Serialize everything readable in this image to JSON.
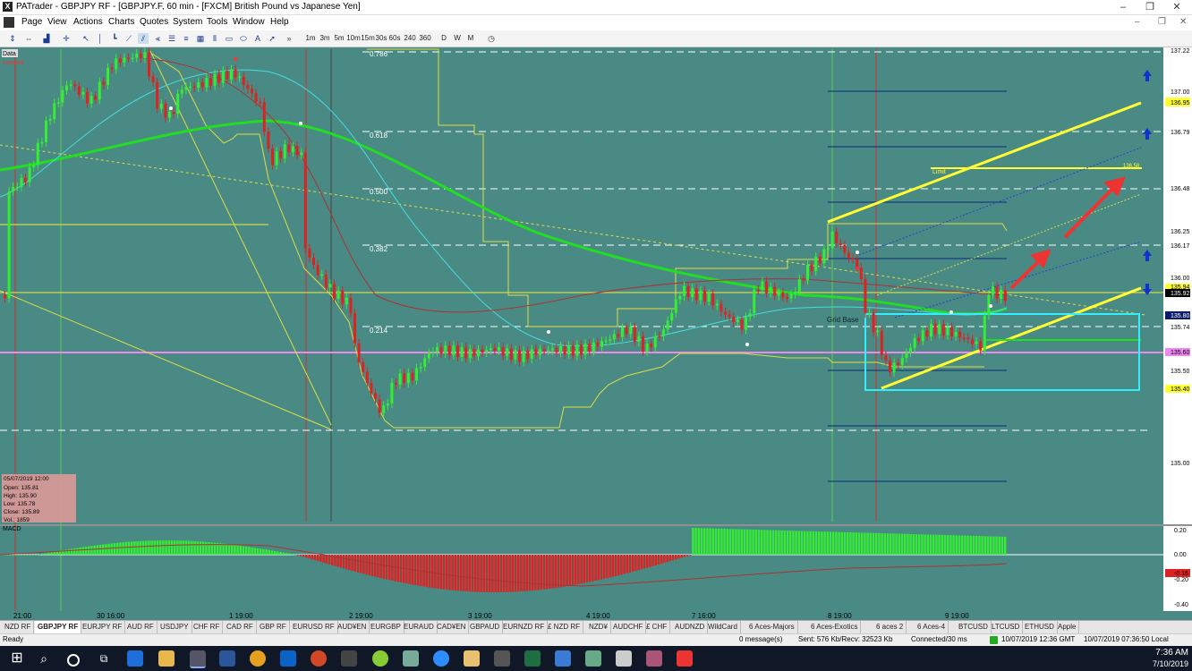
{
  "window": {
    "title": "PATrader - GBPJPY RF - [GBPJPY.F, 60 min - [FXCM] British Pound vs Japanese Yen]",
    "controls": [
      "–",
      "❐",
      "✕"
    ],
    "mdi_controls": [
      "–",
      "❐",
      "✕"
    ]
  },
  "menu": [
    "Page",
    "View",
    "Actions",
    "Charts",
    "Quotes",
    "System",
    "Tools",
    "Window",
    "Help"
  ],
  "toolbar": {
    "timeframes": [
      "1m",
      "3m",
      "5m",
      "10m",
      "15m",
      "30s",
      "60s",
      "240",
      "360"
    ],
    "periods": [
      "D",
      "W",
      "M"
    ],
    "more": "»"
  },
  "chart": {
    "data_label": "Data",
    "status_label": "Leased",
    "fib_levels": [
      "0.786",
      "0.618",
      "0.500",
      "0.382",
      "0.214"
    ],
    "grid_base_label": "Grid Base",
    "limit_label": "Limit",
    "limit_price": "136.58",
    "price_axis": [
      "137.22",
      "137.00",
      "136.95",
      "136.79",
      "136.48",
      "136.25",
      "136.17",
      "136.00",
      "135.94",
      "135.92",
      "135.80",
      "135.74",
      "135.60",
      "135.50",
      "135.40",
      "135.00"
    ],
    "time_axis": [
      "21:00",
      "30 16:00",
      "1 19:00",
      "2 19:00",
      "3 19:00",
      "4 19:00",
      "7 16:00",
      "8 19:00",
      "9 19:00"
    ],
    "info_box": {
      "date": "05/07/2019 12:00",
      "open": "Open: 135.81",
      "high": "High: 135.90",
      "low": "Low: 135.78",
      "close": "Close: 135.89",
      "vol": "Vol.: 1859"
    },
    "macd_label": "MACD",
    "macd_axis": [
      "0.20",
      "0.00",
      "-0.20",
      "-0.40"
    ],
    "macd_value": "-0.16",
    "colors": {
      "background": "#4a8a84",
      "bull": "#33ee33",
      "bear": "#dd2222",
      "ma_green": "#22dd22",
      "ma_cyan": "#44dddd",
      "yellow": "#ffff33",
      "magenta": "#ee88ee",
      "arrow": "#ee3333",
      "box": "#33eeff"
    }
  },
  "tabs": [
    "NZD RF",
    "GBPJPY RF",
    "EURJPY RF",
    "AUD RF",
    "USDJPY",
    "CHF RF",
    "CAD RF",
    "GBP RF",
    "EURUSD RF",
    "AUD¥EN",
    "EURGBP",
    "EURAUD",
    "CAD¥EN",
    "GBPAUD",
    "EURNZD RF",
    "£ NZD RF",
    "NZD¥",
    "AUDCHF",
    "£ CHF",
    "AUDNZD",
    "WildCard",
    "6 Aces-Majors",
    "6 Aces-Exotics",
    "6 aces 2",
    "6 Aces-4",
    "BTCUSD",
    "LTCUSD",
    "ETHUSD",
    "Apple"
  ],
  "active_tab": "GBPJPY RF",
  "status": {
    "ready": "Ready",
    "messages": "0 message(s)",
    "traffic": "Sent: 576 Kb/Recv: 32523 Kb",
    "connection": "Connected/30 ms",
    "time_gmt": "10/07/2019 12:36 GMT",
    "time_local": "10/07/2019 07:36:50 Local"
  },
  "taskbar": {
    "clock_time": "7:36 AM",
    "clock_date": "7/10/2019"
  }
}
